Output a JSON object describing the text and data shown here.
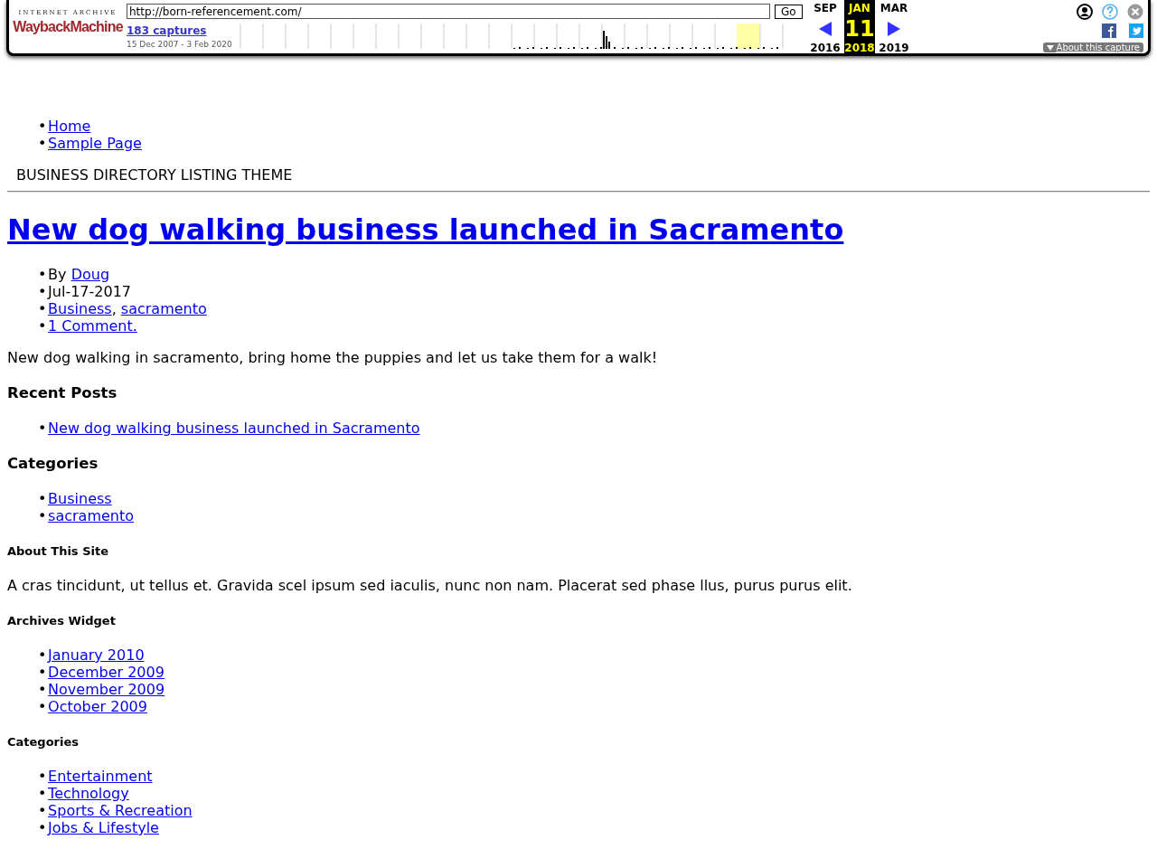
{
  "toolbar": {
    "logo_top": "INTERNET ARCHIVE",
    "logo": "WaybackMachine",
    "url": "http://born-referencement.com/",
    "go": "Go",
    "captures": "183 captures",
    "range": "15 Dec 2007 - 3 Feb 2020",
    "calendar": [
      {
        "month": "SEP",
        "year": "2016",
        "selected": false
      },
      {
        "month": "JAN",
        "day": "11",
        "year": "2018",
        "selected": true
      },
      {
        "month": "MAR",
        "year": "2019",
        "selected": false
      }
    ],
    "about": "About this capture"
  },
  "bullet": "•",
  "nav": [
    "Home",
    "Sample Page"
  ],
  "site_title": "BUSINESS DIRECTORY LISTING THEME",
  "post": {
    "title": "New dog walking business launched in Sacramento",
    "by": "By",
    "author": "Doug",
    "date": "Jul-17-2017",
    "categories": [
      "Business",
      "sacramento"
    ],
    "separator": ",",
    "comments": "1 Comment.",
    "body": "New dog walking in sacramento, bring home the puppies and let us take them for a walk!"
  },
  "widgets": [
    {
      "heading": {
        "kind": "major",
        "text": "Recent Posts"
      },
      "kind": "links",
      "items": [
        "New dog walking business launched in Sacramento"
      ]
    },
    {
      "heading": {
        "kind": "major",
        "text": "Categories"
      },
      "kind": "links",
      "items": [
        "Business",
        "sacramento"
      ]
    },
    {
      "heading": {
        "kind": "minor",
        "text": "About This Site"
      },
      "kind": "text",
      "text": "A cras tincidunt, ut tellus et. Gravida scel ipsum sed iaculis, nunc non nam. Placerat sed phase llus, purus purus elit."
    },
    {
      "heading": {
        "kind": "minor",
        "text": "Archives Widget"
      },
      "kind": "links",
      "items": [
        "January 2010",
        "December 2009",
        "November 2009",
        "October 2009"
      ]
    },
    {
      "heading": {
        "kind": "minor",
        "text": "Categories"
      },
      "kind": "links",
      "items": [
        "Entertainment",
        "Technology",
        "Sports & Recreation",
        "Jobs & Lifestyle"
      ]
    }
  ]
}
